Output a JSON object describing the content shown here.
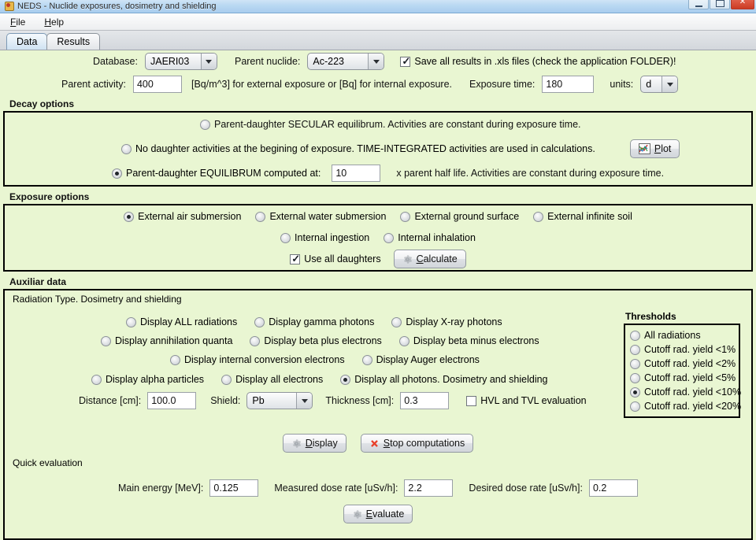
{
  "window": {
    "title": "NEDS - Nuclide exposures, dosimetry and shielding",
    "icon": "app-icon",
    "buttons": {
      "minimize": "—",
      "restore": "❐",
      "close": "✕"
    }
  },
  "menu": {
    "items": [
      {
        "label": "File"
      },
      {
        "label": "Help"
      }
    ]
  },
  "tabs": [
    {
      "label": "Data",
      "active": true
    },
    {
      "label": "Results",
      "active": false
    }
  ],
  "top": {
    "database_label": "Database:",
    "database_value": "JAERI03",
    "parent_nuclide_label": "Parent nuclide:",
    "parent_nuclide_value": "Ac-223",
    "save_xls_label": "Save all results in .xls files (check the application FOLDER)!",
    "save_xls_checked": true,
    "parent_activity_label": "Parent activity:",
    "parent_activity_value": "400",
    "activity_units_note": "[Bq/m^3] for external exposure or [Bq] for internal exposure.",
    "exposure_time_label": "Exposure time:",
    "exposure_time_value": "180",
    "units_label": "units:",
    "units_value": "d"
  },
  "decay": {
    "title": "Decay options",
    "options": [
      {
        "label": "Parent-daughter SECULAR equilibrum. Activities are constant during exposure time.",
        "selected": false
      },
      {
        "label": "No daughter activities at the begining of exposure. TIME-INTEGRATED activities are used in calculations.",
        "selected": false
      },
      {
        "label": "Parent-daughter EQUILIBRUM computed at:",
        "selected": true
      }
    ],
    "equilibrium_value": "10",
    "equilibrium_suffix": "x parent half life. Activities are constant during exposure time.",
    "plot_button": "Plot"
  },
  "exposure": {
    "title": "Exposure options",
    "row1": [
      {
        "label": "External air submersion",
        "selected": true
      },
      {
        "label": "External water submersion",
        "selected": false
      },
      {
        "label": "External ground surface",
        "selected": false
      },
      {
        "label": "External infinite soil",
        "selected": false
      }
    ],
    "row2": [
      {
        "label": "Internal ingestion",
        "selected": false
      },
      {
        "label": "Internal inhalation",
        "selected": false
      }
    ],
    "use_all_daughters_label": "Use all daughters",
    "use_all_daughters_checked": true,
    "calculate_button": "Calculate"
  },
  "auxiliar": {
    "title": "Auxiliar data",
    "radiation": {
      "title": "Radiation Type. Dosimetry and shielding",
      "row1": [
        {
          "label": "Display ALL radiations",
          "selected": false
        },
        {
          "label": "Display gamma photons",
          "selected": false
        },
        {
          "label": "Display X-ray photons",
          "selected": false
        }
      ],
      "row2": [
        {
          "label": "Display annihilation quanta",
          "selected": false
        },
        {
          "label": "Display beta plus electrons",
          "selected": false
        },
        {
          "label": "Display beta minus electrons",
          "selected": false
        }
      ],
      "row3": [
        {
          "label": "Display internal conversion electrons",
          "selected": false
        },
        {
          "label": "Display Auger electrons",
          "selected": false
        }
      ],
      "row4": [
        {
          "label": "Display alpha particles",
          "selected": false
        },
        {
          "label": "Display all electrons",
          "selected": false
        },
        {
          "label": "Display all photons. Dosimetry and shielding",
          "selected": true
        }
      ],
      "distance_label": "Distance [cm]:",
      "distance_value": "100.0",
      "shield_label": "Shield:",
      "shield_value": "Pb",
      "thickness_label": "Thickness [cm]:",
      "thickness_value": "0.3",
      "hvl_label": "HVL and TVL evaluation",
      "hvl_checked": false
    },
    "thresholds": {
      "title": "Thresholds",
      "options": [
        {
          "label": "All radiations",
          "selected": false
        },
        {
          "label": "Cutoff rad. yield <1%",
          "selected": false
        },
        {
          "label": "Cutoff rad. yield <2%",
          "selected": false
        },
        {
          "label": "Cutoff rad. yield <5%",
          "selected": false
        },
        {
          "label": "Cutoff rad. yield <10%",
          "selected": true
        },
        {
          "label": "Cutoff rad. yield <20%",
          "selected": false
        }
      ]
    },
    "display_button": "Display",
    "stop_button": "Stop computations"
  },
  "quick": {
    "title": "Quick evaluation",
    "main_energy_label": "Main energy [MeV]:",
    "main_energy_value": "0.125",
    "measured_label": "Measured dose rate [uSv/h]:",
    "measured_value": "2.2",
    "desired_label": "Desired dose rate [uSv/h]:",
    "desired_value": "0.2",
    "evaluate_button": "Evaluate"
  },
  "colors": {
    "panel_bg": "#e9f6d2",
    "accent_title": "#b9d8f2",
    "close_button": "#cc3b23",
    "stop_icon": "#e8402a"
  }
}
